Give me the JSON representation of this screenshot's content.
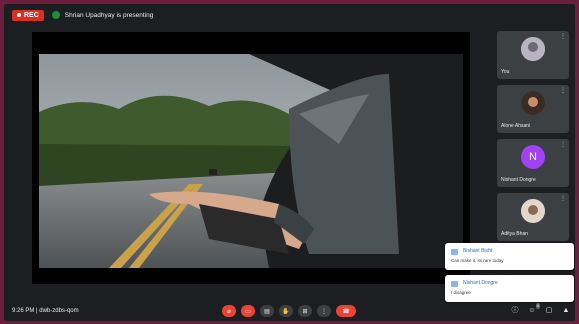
{
  "topbar": {
    "rec_label": "REC",
    "presenting_text": "Shrian Upadhyay is presenting"
  },
  "participants": [
    {
      "name": "You",
      "avatar_initial": ""
    },
    {
      "name": "Alone Ahsani",
      "avatar_initial": ""
    },
    {
      "name": "Nishant Dongre",
      "avatar_initial": "N",
      "avatar_color": "#a142f4"
    },
    {
      "name": "Aditya Bhan",
      "avatar_initial": ""
    }
  ],
  "notifications": [
    {
      "name": "Bishant Bisht",
      "message": "Can make it, its rare today"
    },
    {
      "name": "Nishant Dongre",
      "message": "I disagree"
    }
  ],
  "bottombar": {
    "time": "9:26 PM",
    "meeting_code": "dwb-zdbs-qom",
    "end_call_icon": "call-end-icon",
    "participants_badge": "4"
  },
  "colors": {
    "background": "#6b1f3c",
    "accent_red": "#ea4335",
    "link_blue": "#1a73e8"
  }
}
